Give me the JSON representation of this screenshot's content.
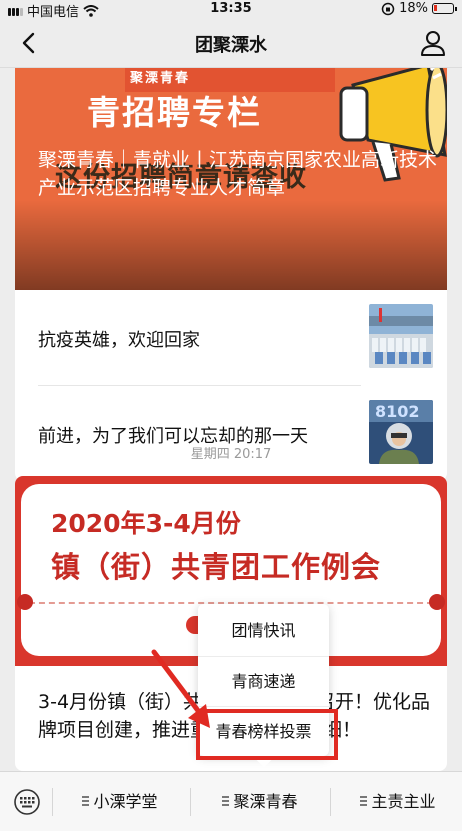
{
  "status_bar": {
    "carrier": "中国电信",
    "time": "13:35",
    "battery": "18%"
  },
  "nav": {
    "title": "团聚溧水",
    "back_icon": "chevron-left-icon",
    "profile_icon": "person-icon"
  },
  "feed": {
    "group1": {
      "cover_text_top": "聚溧青春",
      "cover_text_title": "青招聘专栏",
      "cover_text_sub": "这份招聘简章请查收",
      "headline": "聚溧青春｜青就业丨江苏南京国家农业高新技术产业示范区招聘专业人才简章",
      "items": [
        {
          "title": "抗疫英雄，欢迎回家"
        },
        {
          "title": "前进，为了我们可以忘却的那一天"
        }
      ]
    },
    "timestamp": "星期四 20:17",
    "group2": {
      "cover_text_date": "2020年3-4月份",
      "cover_text_meeting": "镇（街）共青团工作例会",
      "headline": "3-4月份镇（街）共青团工作例会召开！优化品牌项目创建，推进重点工作落实落细！"
    }
  },
  "popup_menu": {
    "items": [
      "团情快讯",
      "青商速递",
      "青春榜样投票"
    ],
    "highlighted_index": 2
  },
  "bottom_menu": {
    "keyboard_icon": "keyboard-icon",
    "tabs": [
      "小溧学堂",
      "聚溧青春",
      "主责主业"
    ]
  },
  "colors": {
    "accent_red": "#e02a22",
    "cover_orange": "#ea6a3e",
    "cover_red": "#d9362c"
  }
}
